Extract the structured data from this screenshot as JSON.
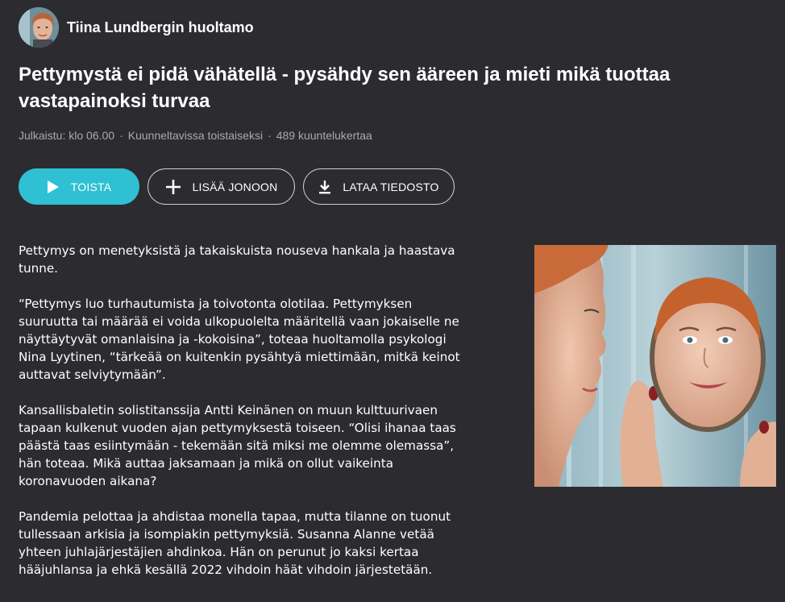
{
  "series": {
    "title": "Tiina Lundbergin huoltamo",
    "avatar_icon": "host-portrait"
  },
  "episode": {
    "title": "Pettymystä ei pidä vähätellä - pysähdy sen ääreen ja mieti mikä tuottaa vastapainoksi turvaa"
  },
  "meta": {
    "published": "Julkaistu: klo 06.00",
    "separator": "·",
    "availability": "Kuunneltavissa toistaiseksi",
    "listens": "489 kuuntelukertaa"
  },
  "actions": {
    "play_label": "TOISTA",
    "queue_label": "LISÄÄ JONOON",
    "download_label": "LATAA TIEDOSTO",
    "play_icon": "play-icon",
    "queue_icon": "plus-icon",
    "download_icon": "download-icon",
    "accent": "#2fc0d4"
  },
  "body": {
    "paragraphs": [
      "Pettymys on menetyksistä ja takaiskuista nouseva hankala ja haastava tunne.",
      "“Pettymys luo turhautumista ja toivotonta olotilaa. Pettymyksen suuruutta tai määrää ei voida ulkopuolelta määritellä vaan jokaiselle ne näyttäytyvät omanlaisina ja -kokoisina”, toteaa huoltamolla psykologi Nina Lyytinen, “tärkeää on kuitenkin pysähtyä miettimään, mitkä keinot auttavat selviytymään”.",
      "Kansallisbaletin solistitanssija Antti Keinänen on muun kulttuurivaen tapaan kulkenut vuoden ajan pettymyksestä toiseen. “Olisi ihanaa taas päästä taas esiintymään - tekemään sitä miksi me olemme olemassa”, hän toteaa. Mikä auttaa jaksamaan ja mikä on ollut vaikeinta koronavuoden aikana?",
      "Pandemia pelottaa ja ahdistaa monella tapaa, mutta tilanne on tuonut tullessaan arkisia ja isompiakin pettymyksiä. Susanna Alanne vetää yhteen juhlajärjestäjien ahdinkoa. Hän on perunut jo kaksi kertaa hääjuhlansa ja ehkä kesällä 2022 vihdoin häät vihdoin järjestetään."
    ]
  },
  "image": {
    "subject": "woman-with-hand-mirror"
  }
}
